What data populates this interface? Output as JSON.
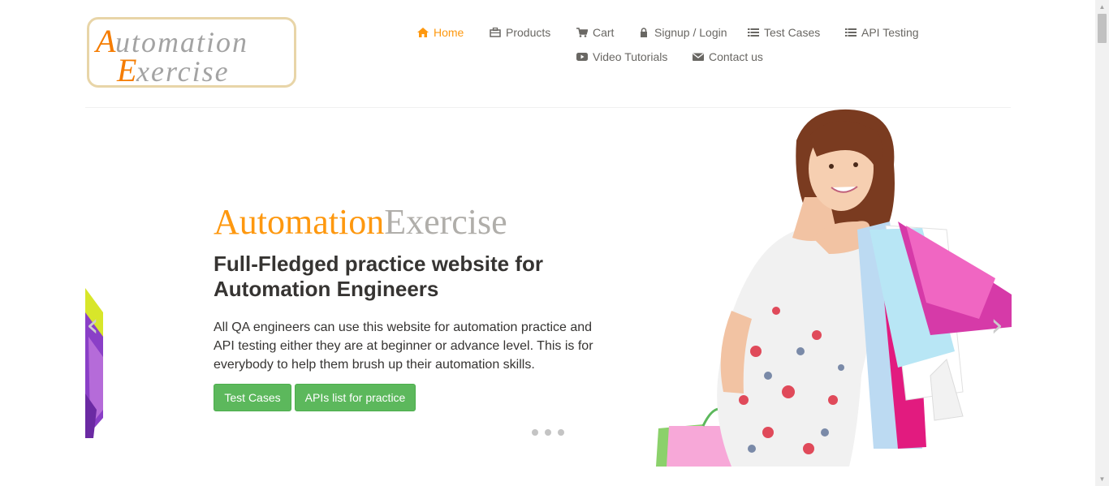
{
  "logo": {
    "line1": "Automation",
    "line2": "Exercise",
    "colors": {
      "accent": "#f57c00",
      "text": "#9e9e9e",
      "border": "#e8d5a8"
    }
  },
  "nav": {
    "items": [
      {
        "label": "Home",
        "icon": "home-icon",
        "active": true
      },
      {
        "label": "Products",
        "icon": "products-icon"
      },
      {
        "label": "Cart",
        "icon": "cart-icon"
      },
      {
        "label": "Signup / Login",
        "icon": "lock-icon"
      },
      {
        "label": "Test Cases",
        "icon": "list-icon"
      },
      {
        "label": "API Testing",
        "icon": "list-icon"
      },
      {
        "label": "Video Tutorials",
        "icon": "youtube-icon"
      },
      {
        "label": "Contact us",
        "icon": "envelope-icon"
      }
    ],
    "colors": {
      "active": "#fe980f",
      "default": "#696763"
    }
  },
  "slider": {
    "brand_part1": "Automation",
    "brand_part2": "Exercise",
    "headline": "Full-Fledged practice website for Automation Engineers",
    "description": "All QA engineers can use this website for automation practice and API testing either they are at beginner or advance level. This is for everybody to help them brush up their automation skills.",
    "buttons": {
      "test_cases": "Test Cases",
      "apis": "APIs list for practice"
    },
    "indicator_count": 3,
    "prev_arrow": "‹",
    "next_arrow": "›",
    "colors": {
      "brand_a": "#fe980f",
      "brand_b": "#b0aeaa",
      "button": "#5cb85c"
    }
  }
}
